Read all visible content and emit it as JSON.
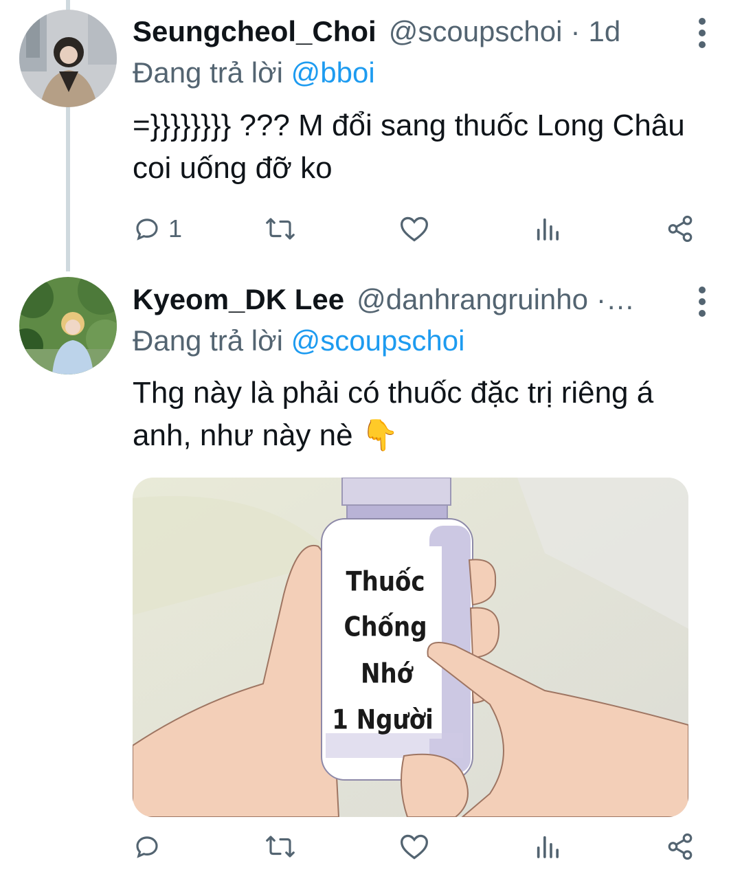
{
  "tweets": [
    {
      "display_name": "Seungcheol_Choi",
      "handle": "@scoupschoi",
      "separator": "·",
      "time": "1d",
      "replying_prefix": "Đang trả lời",
      "replying_to": "@bboi",
      "text_line1": "=}}}}}}}} ??? M đổi sang thuốc Long Châu",
      "text_line2": "coi uống đỡ ko",
      "reply_count": "1"
    },
    {
      "display_name": "Kyeom_DK Lee",
      "handle": "@danhrangruinho",
      "separator": "·…",
      "replying_prefix": "Đang trả lời",
      "replying_to": "@scoupschoi",
      "text_line1": "Thg này là phải có thuốc đặc trị riêng á",
      "text_line2": "anh, như này nè",
      "emoji": "👇",
      "image_label": [
        "Thuốc",
        "Chống",
        "Nhớ",
        "1 Người"
      ]
    }
  ],
  "icons": {
    "reply": "reply-icon",
    "retweet": "retweet-icon",
    "like": "heart-icon",
    "views": "analytics-icon",
    "share": "share-icon",
    "more": "more-vertical-icon"
  },
  "colors": {
    "text": "#0f1419",
    "secondary": "#536471",
    "link": "#1d9bf0",
    "thread_line": "#cfd9de"
  }
}
